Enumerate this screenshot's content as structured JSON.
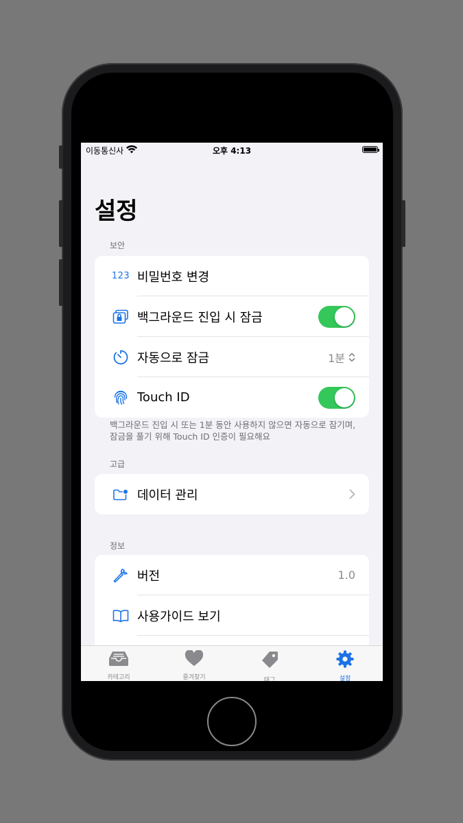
{
  "status_bar": {
    "carrier": "이동통신사",
    "time": "오후 4:13"
  },
  "page": {
    "title": "설정"
  },
  "sections": {
    "security": {
      "header": "보안",
      "items": [
        {
          "label": "비밀번호 변경",
          "icon": "123-icon",
          "icon_text": "123"
        },
        {
          "label": "백그라운드 진입 시 잠금",
          "icon": "lock-screen-icon",
          "toggle": true
        },
        {
          "label": "자동으로 잠금",
          "icon": "timer-icon",
          "value": "1분"
        },
        {
          "label": "Touch ID",
          "icon": "fingerprint-icon",
          "toggle": true
        }
      ],
      "footer": "백그라운드 진입 시 또는 1분 동안 사용하지 않으면 자동으로 잠기며, 잠금을 풀기 위해 Touch ID 인증이 필요해요"
    },
    "advanced": {
      "header": "고급",
      "items": [
        {
          "label": "데이터 관리",
          "icon": "folder-gear-icon"
        }
      ]
    },
    "info": {
      "header": "정보",
      "items": [
        {
          "label": "버전",
          "icon": "wrench-icon",
          "value": "1.0"
        },
        {
          "label": "사용가이드 보기",
          "icon": "book-icon"
        }
      ]
    }
  },
  "tabbar": {
    "tabs": [
      {
        "label": "카테고리",
        "icon": "tray-icon"
      },
      {
        "label": "즐겨찾기",
        "icon": "heart-icon"
      },
      {
        "label": "태그",
        "icon": "tag-icon"
      },
      {
        "label": "설정",
        "icon": "gear-icon",
        "active": true
      }
    ]
  },
  "colors": {
    "accent": "#1a73e8",
    "toggle_on": "#34c759",
    "background": "#f2f2f7"
  }
}
